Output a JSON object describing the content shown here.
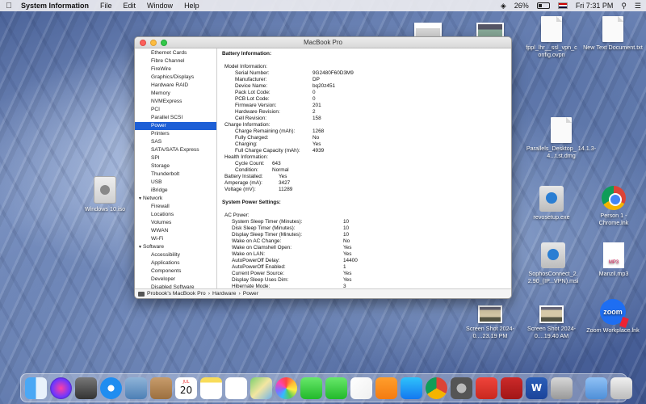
{
  "menubar": {
    "app_name": "System Information",
    "menus": [
      "File",
      "Edit",
      "Window",
      "Help"
    ],
    "battery_percent": "26%",
    "clock": "Fri 7:31 PM"
  },
  "window": {
    "title": "MacBook Pro",
    "sidebar": [
      {
        "label": "Ethernet Cards",
        "type": "item"
      },
      {
        "label": "Fibre Channel",
        "type": "item"
      },
      {
        "label": "FireWire",
        "type": "item"
      },
      {
        "label": "Graphics/Displays",
        "type": "item"
      },
      {
        "label": "Hardware RAID",
        "type": "item"
      },
      {
        "label": "Memory",
        "type": "item"
      },
      {
        "label": "NVMExpress",
        "type": "item"
      },
      {
        "label": "PCI",
        "type": "item"
      },
      {
        "label": "Parallel SCSI",
        "type": "item"
      },
      {
        "label": "Power",
        "type": "item",
        "selected": true
      },
      {
        "label": "Printers",
        "type": "item"
      },
      {
        "label": "SAS",
        "type": "item"
      },
      {
        "label": "SATA/SATA Express",
        "type": "item"
      },
      {
        "label": "SPI",
        "type": "item"
      },
      {
        "label": "Storage",
        "type": "item"
      },
      {
        "label": "Thunderbolt",
        "type": "item"
      },
      {
        "label": "USB",
        "type": "item"
      },
      {
        "label": "iBridge",
        "type": "item"
      },
      {
        "label": "Network",
        "type": "group"
      },
      {
        "label": "Firewall",
        "type": "item"
      },
      {
        "label": "Locations",
        "type": "item"
      },
      {
        "label": "Volumes",
        "type": "item"
      },
      {
        "label": "WWAN",
        "type": "item"
      },
      {
        "label": "Wi-Fi",
        "type": "item"
      },
      {
        "label": "Software",
        "type": "group"
      },
      {
        "label": "Accessibility",
        "type": "item"
      },
      {
        "label": "Applications",
        "type": "item"
      },
      {
        "label": "Components",
        "type": "item"
      },
      {
        "label": "Developer",
        "type": "item"
      },
      {
        "label": "Disabled Software",
        "type": "item"
      }
    ],
    "content": [
      {
        "t": "heading",
        "k": "Battery Information:"
      },
      {
        "t": "gap"
      },
      {
        "t": "row",
        "i": 1,
        "k": "Model Information:",
        "v": ""
      },
      {
        "t": "row",
        "i": 3,
        "k": "Serial Number:",
        "v": "9G2480F60D3M9"
      },
      {
        "t": "row",
        "i": 3,
        "k": "Manufacturer:",
        "v": "DP"
      },
      {
        "t": "row",
        "i": 3,
        "k": "Device Name:",
        "v": "bq20z451"
      },
      {
        "t": "row",
        "i": 3,
        "k": "Pack Lot Code:",
        "v": "0"
      },
      {
        "t": "row",
        "i": 3,
        "k": "PCB Lot Code:",
        "v": "0"
      },
      {
        "t": "row",
        "i": 3,
        "k": "Firmware Version:",
        "v": "201"
      },
      {
        "t": "row",
        "i": 3,
        "k": "Hardware Revision:",
        "v": "2"
      },
      {
        "t": "row",
        "i": 3,
        "k": "Cell Revision:",
        "v": "158"
      },
      {
        "t": "row",
        "i": 1,
        "k": "Charge Information:",
        "v": ""
      },
      {
        "t": "row",
        "i": 3,
        "k": "Charge Remaining (mAh):",
        "v": "1268"
      },
      {
        "t": "row",
        "i": 3,
        "k": "Fully Charged:",
        "v": "No"
      },
      {
        "t": "row",
        "i": 3,
        "k": "Charging:",
        "v": "Yes"
      },
      {
        "t": "row",
        "i": 3,
        "k": "Full Charge Capacity (mAh):",
        "v": "4939"
      },
      {
        "t": "row",
        "i": 1,
        "k": "Health Information:",
        "v": ""
      },
      {
        "t": "row",
        "i": 3,
        "k": "Cycle Count:",
        "v": "643",
        "vx": 62
      },
      {
        "t": "row",
        "i": 3,
        "k": "Condition:",
        "v": "Normal",
        "vx": 62
      },
      {
        "t": "row",
        "i": 1,
        "k": "Battery Installed:",
        "v": "Yes",
        "vx": 70
      },
      {
        "t": "row",
        "i": 1,
        "k": "Amperage (mA):",
        "v": "3427",
        "vx": 70
      },
      {
        "t": "row",
        "i": 1,
        "k": "Voltage (mV):",
        "v": "11289",
        "vx": 70
      },
      {
        "t": "gap"
      },
      {
        "t": "heading",
        "k": "System Power Settings:"
      },
      {
        "t": "gap"
      },
      {
        "t": "row",
        "i": 1,
        "k": "AC Power:",
        "v": ""
      },
      {
        "t": "row",
        "i": 2,
        "k": "System Sleep Timer (Minutes):",
        "v": "10",
        "vx": 150
      },
      {
        "t": "row",
        "i": 2,
        "k": "Disk Sleep Timer (Minutes):",
        "v": "10",
        "vx": 150
      },
      {
        "t": "row",
        "i": 2,
        "k": "Display Sleep Timer (Minutes):",
        "v": "10",
        "vx": 150
      },
      {
        "t": "row",
        "i": 2,
        "k": "Wake on AC Change:",
        "v": "No",
        "vx": 150
      },
      {
        "t": "row",
        "i": 2,
        "k": "Wake on Clamshell Open:",
        "v": "Yes",
        "vx": 150
      },
      {
        "t": "row",
        "i": 2,
        "k": "Wake on LAN:",
        "v": "Yes",
        "vx": 150
      },
      {
        "t": "row",
        "i": 2,
        "k": "AutoPowerOff Delay:",
        "v": "14400",
        "vx": 150
      },
      {
        "t": "row",
        "i": 2,
        "k": "AutoPowerOff Enabled:",
        "v": "1",
        "vx": 150
      },
      {
        "t": "row",
        "i": 2,
        "k": "Current Power Source:",
        "v": "Yes",
        "vx": 150
      },
      {
        "t": "row",
        "i": 2,
        "k": "Display Sleep Uses Dim:",
        "v": "Yes",
        "vx": 150
      },
      {
        "t": "row",
        "i": 2,
        "k": "Hibernate Mode:",
        "v": "3",
        "vx": 150
      }
    ],
    "statusbar": {
      "path": [
        "Probook's MacBook Pro",
        "Hardware",
        "Power"
      ],
      "separator": "›"
    }
  },
  "desktop_icons": {
    "fppl": "fppl_lhr__ssl_vpn_c onfig.ovpn",
    "new_text": "New Text Document.txt",
    "parallels": "Parallels_Desktop_ 14.1.3-4...t.st.dmg",
    "windows_iso": "Windows 10.iso",
    "revosetup": "revosetup.exe",
    "chrome": "Person 1 - Chrome.lnk",
    "sophos": "SophosConnect_2. 2.90_(IP...VPN).msi",
    "manzil": "Manzil.mp3",
    "shot1": "Screen Shot 2024-0....23.19 PM",
    "shot2": "Screen Shot 2024-0....19.40 AM",
    "zoom": "Zoom Workplace.lnk",
    "zoom_logo": "zoom",
    "mp3_tag": "MP3"
  },
  "dock": {
    "calendar_day": "20",
    "calendar_month": "JUL",
    "word_letter": "W",
    "apps": [
      "Finder",
      "Siri",
      "Launchpad",
      "Safari",
      "Mail",
      "Contacts",
      "Calendar",
      "Notes",
      "Reminders",
      "Maps",
      "Photos",
      "Messages",
      "FaceTime",
      "iTunes",
      "Books",
      "App Store",
      "Chrome",
      "System Preferences",
      "AnyDesk",
      "Windows",
      "Word",
      "Installer",
      "Downloads",
      "Trash"
    ]
  }
}
